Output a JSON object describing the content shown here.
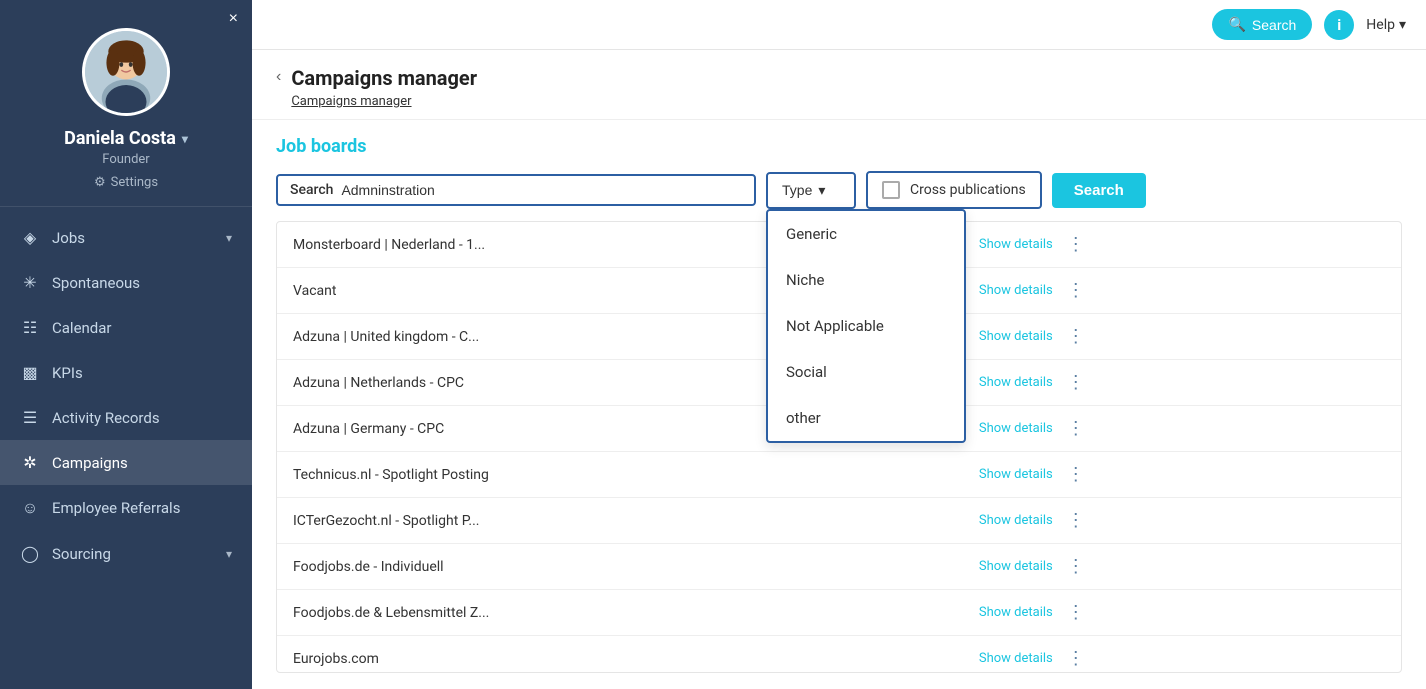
{
  "sidebar": {
    "close_label": "×",
    "user": {
      "name": "Daniela Costa",
      "role": "Founder",
      "settings_label": "Settings"
    },
    "nav_items": [
      {
        "id": "jobs",
        "label": "Jobs",
        "icon": "briefcase",
        "has_chevron": true
      },
      {
        "id": "spontaneous",
        "label": "Spontaneous",
        "icon": "asterisk"
      },
      {
        "id": "calendar",
        "label": "Calendar",
        "icon": "calendar"
      },
      {
        "id": "kpis",
        "label": "KPIs",
        "icon": "chart"
      },
      {
        "id": "activity-records",
        "label": "Activity Records",
        "icon": "list"
      },
      {
        "id": "campaigns",
        "label": "Campaigns",
        "icon": "asterisk2"
      },
      {
        "id": "employee-referrals",
        "label": "Employee Referrals",
        "icon": "people"
      },
      {
        "id": "sourcing",
        "label": "Sourcing",
        "icon": "group",
        "has_chevron": true
      }
    ]
  },
  "topbar": {
    "search_btn_label": "Search",
    "help_label": "Help",
    "info_label": "i"
  },
  "page": {
    "title": "Campaigns manager",
    "breadcrumb": "Campaigns manager",
    "back_icon": "‹"
  },
  "job_boards": {
    "section_title": "Job boards",
    "search": {
      "label": "Search",
      "value": "Admninstration"
    },
    "type_dropdown": {
      "label": "Type",
      "options": [
        {
          "value": "Generic",
          "label": "Generic"
        },
        {
          "value": "Niche",
          "label": "Niche"
        },
        {
          "value": "Not Applicable",
          "label": "Not Applicable"
        },
        {
          "value": "Social",
          "label": "Social"
        },
        {
          "value": "other",
          "label": "other"
        }
      ]
    },
    "cross_publications": {
      "label": "Cross publications",
      "checked": false
    },
    "search_btn_label": "Search",
    "rows": [
      {
        "name": "Monsterboard | Nederland - 1...",
        "show_details": "Show details"
      },
      {
        "name": "Vacant",
        "show_details": "Show details"
      },
      {
        "name": "Adzuna | United kingdom - C...",
        "show_details": "Show details"
      },
      {
        "name": "Adzuna | Netherlands - CPC",
        "show_details": "Show details"
      },
      {
        "name": "Adzuna | Germany - CPC",
        "show_details": "Show details"
      },
      {
        "name": "Technicus.nl - Spotlight Posting",
        "show_details": "Show details"
      },
      {
        "name": "ICTerGezocht.nl - Spotlight P...",
        "show_details": "Show details"
      },
      {
        "name": "Foodjobs.de - Individuell",
        "show_details": "Show details"
      },
      {
        "name": "Foodjobs.de & Lebensmittel Z...",
        "show_details": "Show details"
      },
      {
        "name": "Eurojobs.com",
        "show_details": "Show details"
      }
    ]
  }
}
